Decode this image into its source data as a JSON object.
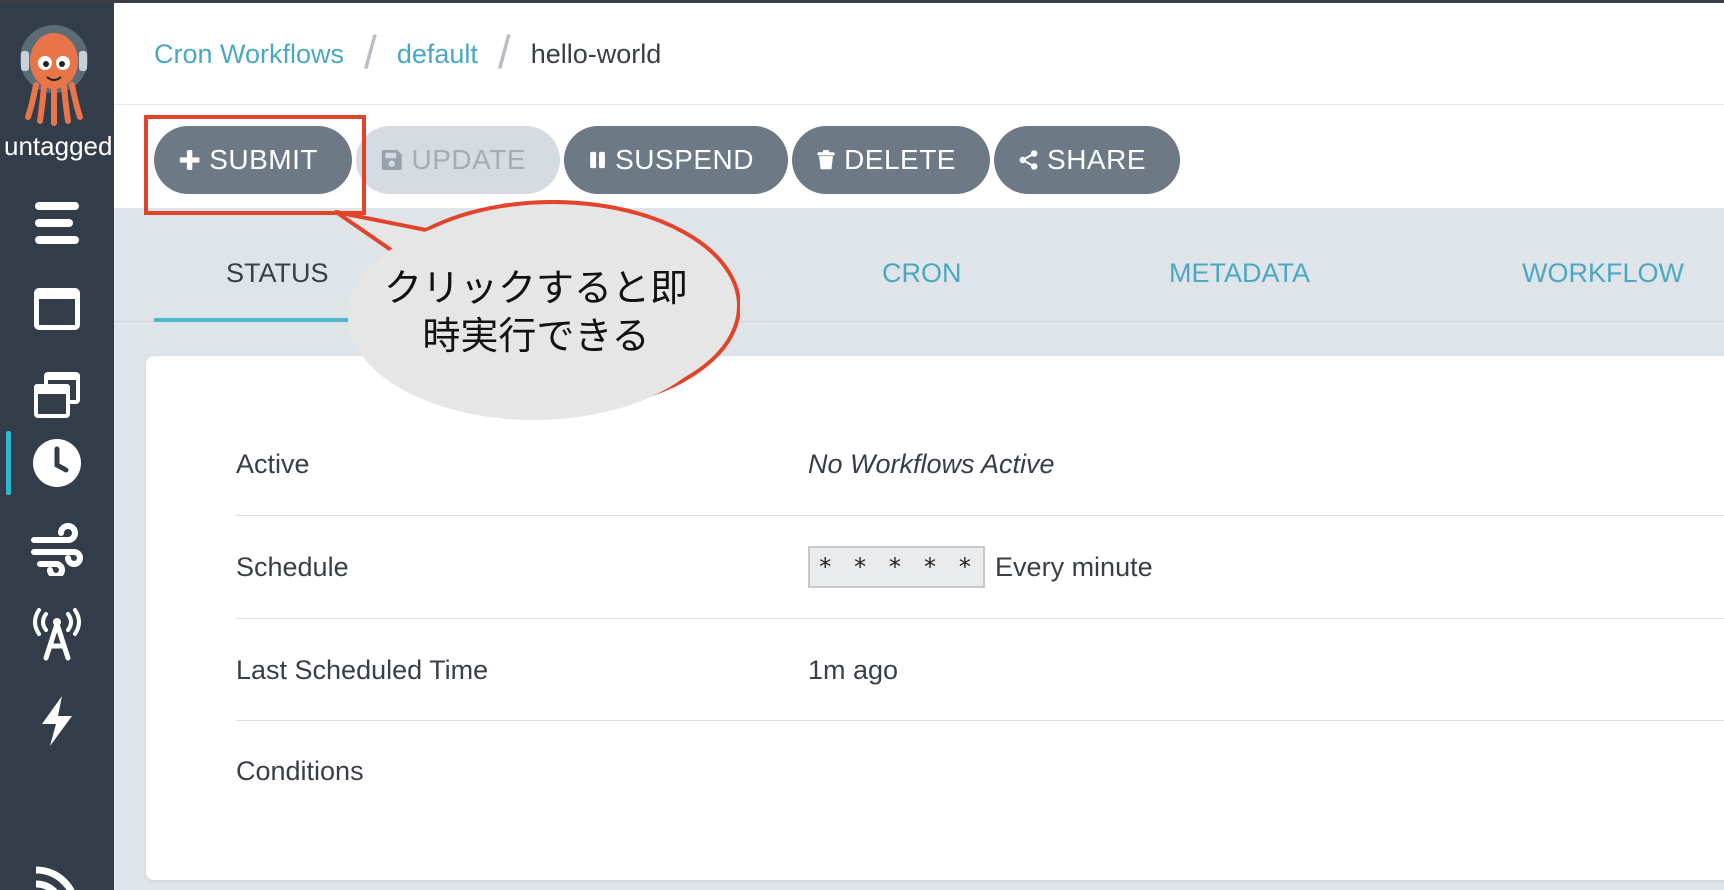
{
  "sidebar": {
    "namespace_label": "untagged",
    "nav_icons": [
      "menu-icon",
      "window-icon",
      "stacked-windows-icon",
      "clock-icon",
      "wind-icon",
      "antenna-icon",
      "lightning-icon",
      "signal-icon"
    ],
    "active_item": "clock-icon",
    "accent_color": "#2fb7cf",
    "background_color": "#333d4a"
  },
  "breadcrumb": {
    "items": [
      "Cron Workflows",
      "default",
      "hello-world"
    ]
  },
  "toolbar": {
    "submit_label": "SUBMIT",
    "update_label": "UPDATE",
    "suspend_label": "SUSPEND",
    "delete_label": "DELETE",
    "share_label": "SHARE"
  },
  "tabs": [
    {
      "label": "STATUS",
      "active": true
    },
    {
      "label": "CRON",
      "active": false
    },
    {
      "label": "METADATA",
      "active": false
    },
    {
      "label": "WORKFLOW",
      "active": false
    }
  ],
  "status": {
    "rows": [
      {
        "label": "Active",
        "value": "No Workflows Active"
      },
      {
        "label": "Schedule",
        "cron": "* * * * *",
        "value": "Every minute"
      },
      {
        "label": "Last Scheduled Time",
        "value": "1m ago"
      },
      {
        "label": "Conditions",
        "value": ""
      }
    ]
  },
  "annotation": {
    "line1": "クリックすると即",
    "line2": "時実行できる",
    "color": "#e2442b"
  },
  "colors": {
    "link": "#4aa8c5",
    "button": "#6d7a86",
    "button_disabled": "#d5dbe0",
    "tab_background": "#dee4e8"
  }
}
